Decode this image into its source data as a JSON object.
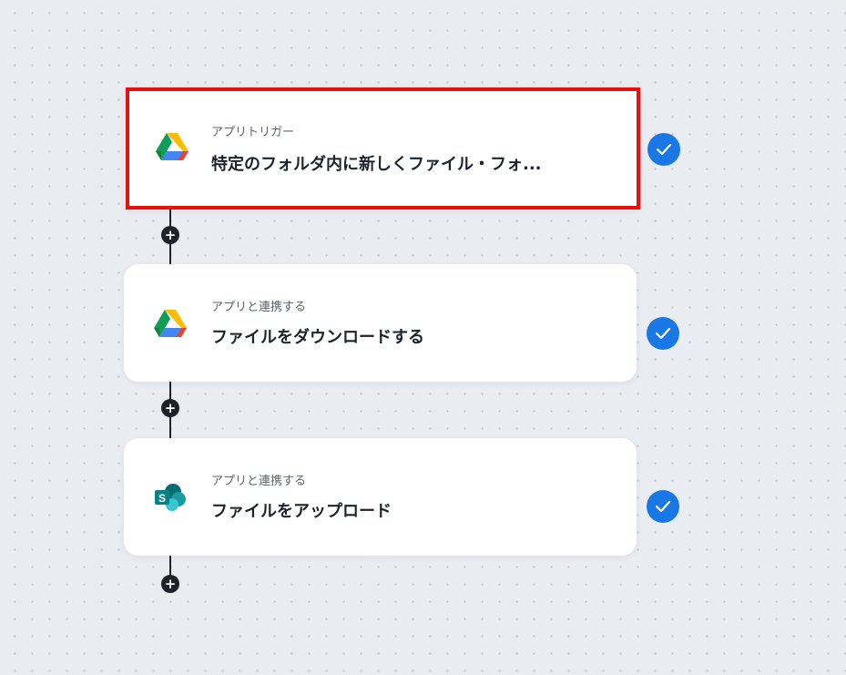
{
  "flow": {
    "steps": [
      {
        "subtitle": "アプリトリガー",
        "title": "特定のフォルダ内に新しくファイル・フォ...",
        "app_icon": "google-drive-icon",
        "status": "completed",
        "selected": true
      },
      {
        "subtitle": "アプリと連携する",
        "title": "ファイルをダウンロードする",
        "app_icon": "google-drive-icon",
        "status": "completed",
        "selected": false
      },
      {
        "subtitle": "アプリと連携する",
        "title": "ファイルをアップロード",
        "app_icon": "sharepoint-icon",
        "status": "completed",
        "selected": false
      }
    ],
    "add_step_symbol": "+"
  },
  "colors": {
    "selection_border": "#e8100c",
    "check_badge": "#1a77e6",
    "connector": "#1f2228",
    "background": "#e9ecf1"
  }
}
